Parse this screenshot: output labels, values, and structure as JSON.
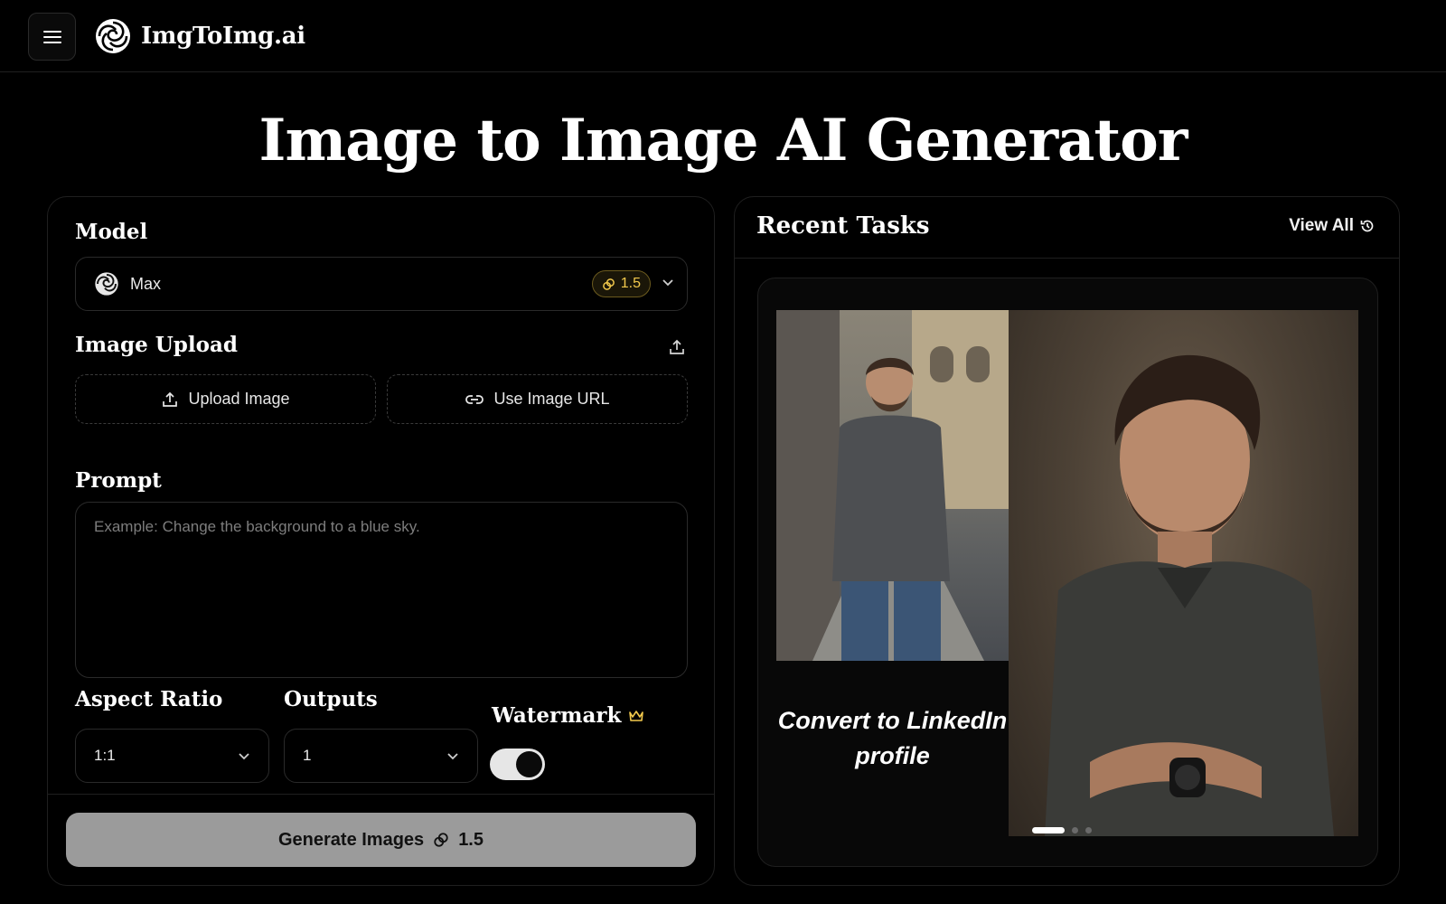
{
  "header": {
    "brand_name": "ImgToImg.ai"
  },
  "page_title": "Image to Image AI Generator",
  "form": {
    "model_label": "Model",
    "model_value": "Max",
    "model_credits": "1.5",
    "image_upload_label": "Image Upload",
    "upload_image_label": "Upload Image",
    "use_url_label": "Use Image URL",
    "prompt_label": "Prompt",
    "prompt_placeholder": "Example: Change the background to a blue sky.",
    "prompt_value": "",
    "aspect_ratio_label": "Aspect Ratio",
    "aspect_ratio_value": "1:1",
    "outputs_label": "Outputs",
    "outputs_value": "1",
    "watermark_label": "Watermark",
    "watermark_enabled": true,
    "generate_label": "Generate Images",
    "generate_credits": "1.5"
  },
  "recent": {
    "title": "Recent Tasks",
    "view_all_label": "View All",
    "card_caption": "Convert to LinkedIn profile",
    "slides_total": 3,
    "active_slide": 1
  },
  "colors": {
    "background": "#000000",
    "credit_gold": "#f2c94c",
    "generate_button": "#9b9b9b",
    "border": "#2a2a2a"
  },
  "icons": {
    "menu": "hamburger-icon",
    "logo": "swirl-logo-icon",
    "credit": "coin-link-icon",
    "upload": "upload-icon",
    "link": "link-icon",
    "watermark_premium": "crown-icon",
    "history": "history-icon"
  }
}
